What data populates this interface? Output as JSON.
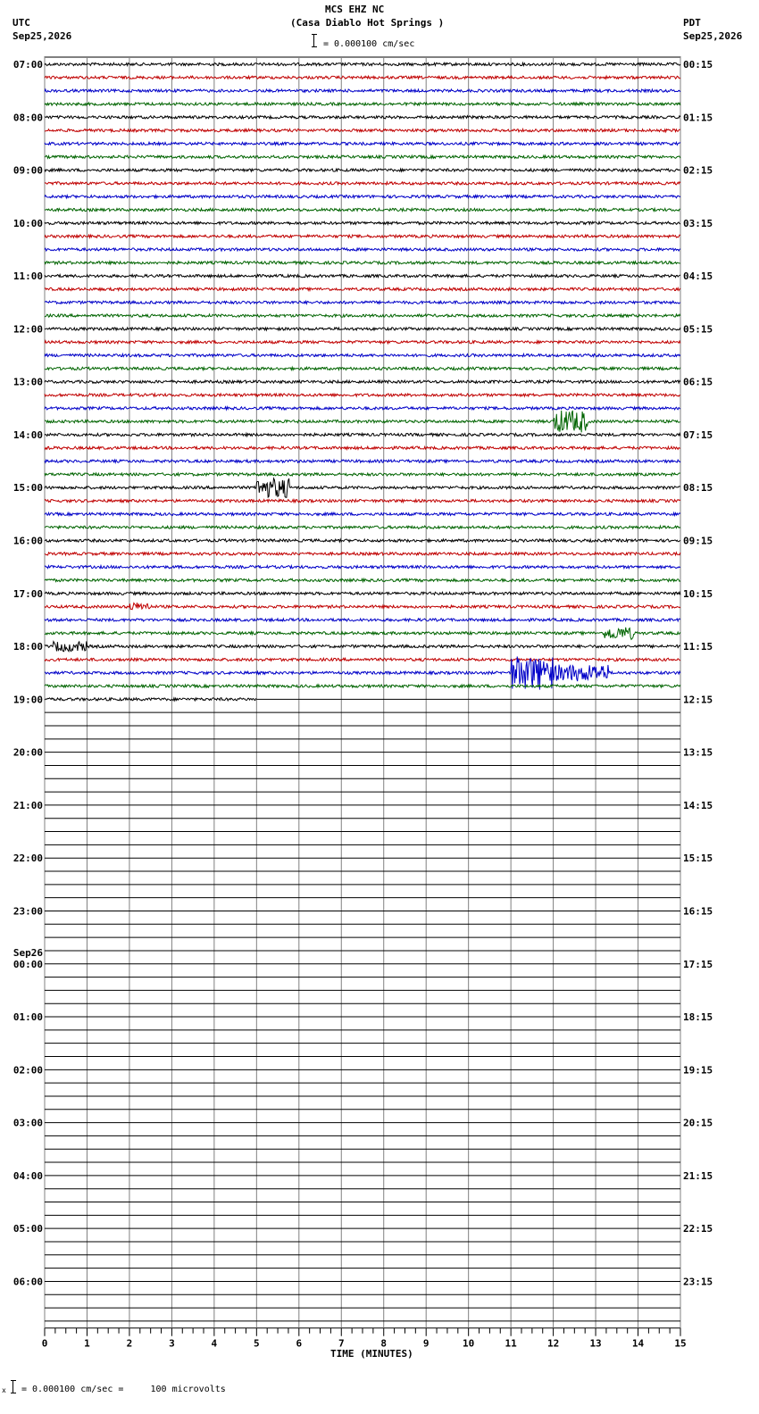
{
  "header": {
    "station": "MCS EHZ NC",
    "location": "(Casa Diablo Hot Springs )",
    "scale_label": "= 0.000100 cm/sec",
    "left_tz": "UTC",
    "left_date": "Sep25,2026",
    "right_tz": "PDT",
    "right_date": "Sep25,2026"
  },
  "footer": {
    "scale_note": "= 0.000100 cm/sec =     100 microvolts"
  },
  "chart_data": {
    "type": "line",
    "title": "MCS EHZ NC (Casa Diablo Hot Springs )",
    "xlabel": "TIME (MINUTES)",
    "xlim": [
      0,
      15
    ],
    "x_ticks": [
      0,
      1,
      2,
      3,
      4,
      5,
      6,
      7,
      8,
      9,
      10,
      11,
      12,
      13,
      14,
      15
    ],
    "rows_per_hour": 4,
    "total_rows": 96,
    "trace_colors": [
      "#000000",
      "#c00000",
      "#0000c8",
      "#006400"
    ],
    "grid_color": "#808080",
    "utc_labels": [
      {
        "row": 0,
        "text": "07:00"
      },
      {
        "row": 4,
        "text": "08:00"
      },
      {
        "row": 8,
        "text": "09:00"
      },
      {
        "row": 12,
        "text": "10:00"
      },
      {
        "row": 16,
        "text": "11:00"
      },
      {
        "row": 20,
        "text": "12:00"
      },
      {
        "row": 24,
        "text": "13:00"
      },
      {
        "row": 28,
        "text": "14:00"
      },
      {
        "row": 32,
        "text": "15:00"
      },
      {
        "row": 36,
        "text": "16:00"
      },
      {
        "row": 40,
        "text": "17:00"
      },
      {
        "row": 44,
        "text": "18:00"
      },
      {
        "row": 48,
        "text": "19:00"
      },
      {
        "row": 52,
        "text": "20:00"
      },
      {
        "row": 56,
        "text": "21:00"
      },
      {
        "row": 60,
        "text": "22:00"
      },
      {
        "row": 64,
        "text": "23:00"
      },
      {
        "row": 68,
        "text": "00:00",
        "date": "Sep26"
      },
      {
        "row": 72,
        "text": "01:00"
      },
      {
        "row": 76,
        "text": "02:00"
      },
      {
        "row": 80,
        "text": "03:00"
      },
      {
        "row": 84,
        "text": "04:00"
      },
      {
        "row": 88,
        "text": "05:00"
      },
      {
        "row": 92,
        "text": "06:00"
      }
    ],
    "pdt_labels": [
      {
        "row": 0,
        "text": "00:15"
      },
      {
        "row": 4,
        "text": "01:15"
      },
      {
        "row": 8,
        "text": "02:15"
      },
      {
        "row": 12,
        "text": "03:15"
      },
      {
        "row": 16,
        "text": "04:15"
      },
      {
        "row": 20,
        "text": "05:15"
      },
      {
        "row": 24,
        "text": "06:15"
      },
      {
        "row": 28,
        "text": "07:15"
      },
      {
        "row": 32,
        "text": "08:15"
      },
      {
        "row": 36,
        "text": "09:15"
      },
      {
        "row": 40,
        "text": "10:15"
      },
      {
        "row": 44,
        "text": "11:15"
      },
      {
        "row": 48,
        "text": "12:15"
      },
      {
        "row": 52,
        "text": "13:15"
      },
      {
        "row": 56,
        "text": "14:15"
      },
      {
        "row": 60,
        "text": "15:15"
      },
      {
        "row": 64,
        "text": "16:15"
      },
      {
        "row": 68,
        "text": "17:15"
      },
      {
        "row": 72,
        "text": "18:15"
      },
      {
        "row": 76,
        "text": "19:15"
      },
      {
        "row": 80,
        "text": "20:15"
      },
      {
        "row": 84,
        "text": "21:15"
      },
      {
        "row": 88,
        "text": "22:15"
      },
      {
        "row": 92,
        "text": "23:15"
      }
    ],
    "last_trace": {
      "row": 48,
      "end_minute": 5.0
    },
    "events": [
      {
        "row": 32,
        "start": 5.0,
        "end": 5.8,
        "amplitude": 3.5
      },
      {
        "row": 44,
        "start": 0.2,
        "end": 1.0,
        "amplitude": 1.8
      },
      {
        "row": 41,
        "start": 2.0,
        "end": 2.5,
        "amplitude": 1.5
      },
      {
        "row": 27,
        "start": 12.0,
        "end": 12.8,
        "amplitude": 4.0
      },
      {
        "row": 43,
        "start": 13.2,
        "end": 13.9,
        "amplitude": 2.2
      },
      {
        "row": 46,
        "start": 11.0,
        "end": 12.0,
        "amplitude": 6.0
      },
      {
        "row": 46,
        "start": 12.0,
        "end": 13.3,
        "amplitude": 3.0
      }
    ]
  }
}
